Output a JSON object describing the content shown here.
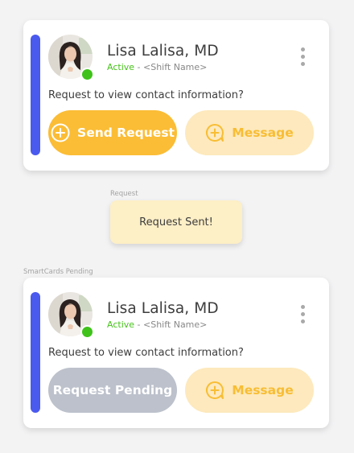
{
  "cards": [
    {
      "name": "Lisa Lalisa, MD",
      "status": "Active",
      "separator": " - ",
      "shift": "<Shift Name>",
      "prompt": "Request to view contact information?",
      "primary_button": "Send Request",
      "message_button": "Message",
      "more_icon": "kebab-menu-icon"
    },
    {
      "name": "Lisa Lalisa, MD",
      "status": "Active",
      "separator": " - ",
      "shift": "<Shift Name>",
      "prompt": "Request to view contact information?",
      "primary_button": "Request Pending",
      "message_button": "Message",
      "more_icon": "kebab-menu-icon"
    }
  ],
  "request_section": {
    "label": "Request",
    "toast": "Request Sent!"
  },
  "pending_section": {
    "label": "SmartCards Pending"
  },
  "colors": {
    "accent_bar": "#4a59ee",
    "status_active": "#47c21b",
    "primary_button": "#fbbd36",
    "pending_button": "#bcc1cb",
    "message_button_bg": "#fde9bd",
    "message_button_text": "#f8bd34",
    "toast_bg": "#fdefc6"
  },
  "icons": {
    "send_request": "plus-circle-icon",
    "message": "chat-plus-icon",
    "online": "online-status-dot"
  }
}
